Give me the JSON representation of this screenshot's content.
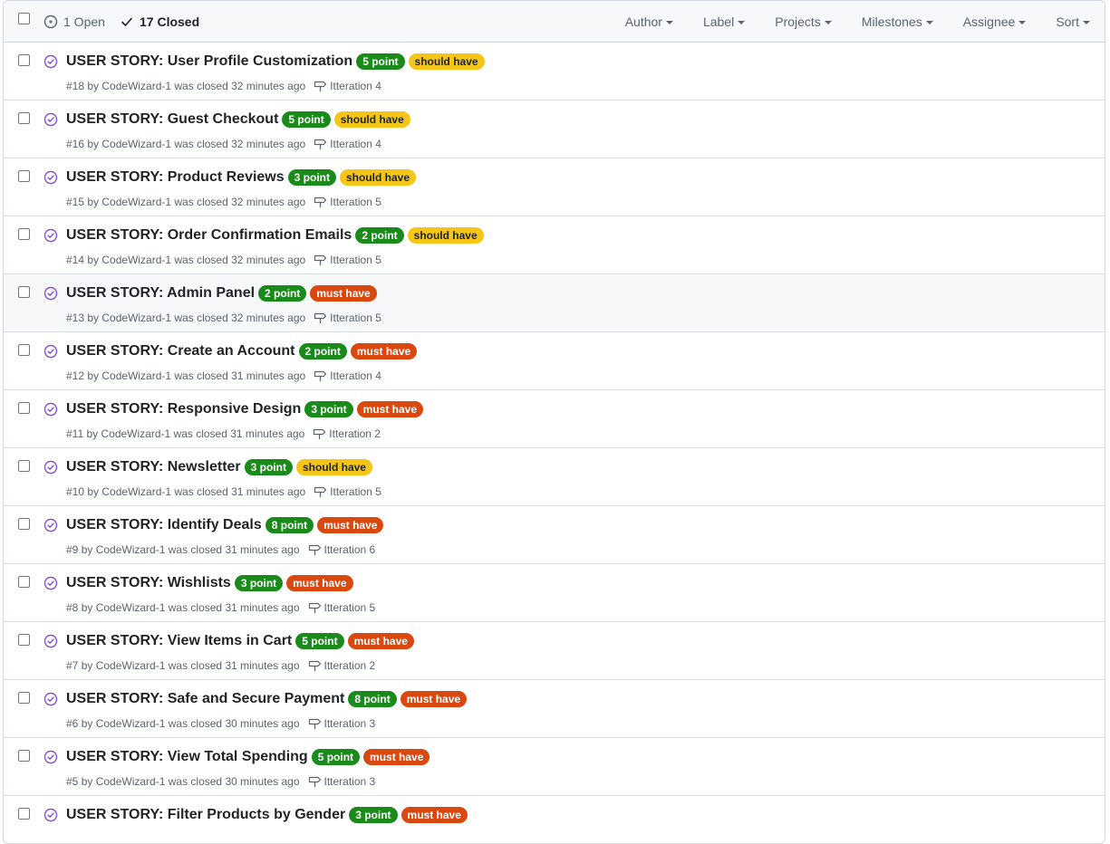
{
  "colors": {
    "point": "#1a8b1a",
    "point_text": "#ffffff",
    "should": "#f5c518",
    "should_text": "#1f2328",
    "must": "#d9480f",
    "must_text": "#ffffff",
    "closed_icon": "#8250df"
  },
  "header": {
    "open_label": "1 Open",
    "closed_label": "17 Closed",
    "filters": [
      "Author",
      "Label",
      "Projects",
      "Milestones",
      "Assignee",
      "Sort"
    ]
  },
  "issues": [
    {
      "title": "USER STORY: User Profile Customization",
      "number": "#18",
      "author": "CodeWizard-1",
      "closed": "32 minutes ago",
      "milestone": "Itteration 4",
      "labels": [
        {
          "text": "5 point",
          "kind": "point"
        },
        {
          "text": "should have",
          "kind": "should"
        }
      ]
    },
    {
      "title": "USER STORY: Guest Checkout",
      "number": "#16",
      "author": "CodeWizard-1",
      "closed": "32 minutes ago",
      "milestone": "Itteration 4",
      "labels": [
        {
          "text": "5 point",
          "kind": "point"
        },
        {
          "text": "should have",
          "kind": "should"
        }
      ]
    },
    {
      "title": "USER STORY: Product Reviews",
      "number": "#15",
      "author": "CodeWizard-1",
      "closed": "32 minutes ago",
      "milestone": "Itteration 5",
      "labels": [
        {
          "text": "3 point",
          "kind": "point"
        },
        {
          "text": "should have",
          "kind": "should"
        }
      ]
    },
    {
      "title": "USER STORY: Order Confirmation Emails",
      "number": "#14",
      "author": "CodeWizard-1",
      "closed": "32 minutes ago",
      "milestone": "Itteration 5",
      "labels": [
        {
          "text": "2 point",
          "kind": "point"
        },
        {
          "text": "should have",
          "kind": "should"
        }
      ]
    },
    {
      "title": "USER STORY: Admin Panel",
      "number": "#13",
      "author": "CodeWizard-1",
      "closed": "32 minutes ago",
      "milestone": "Itteration 5",
      "labels": [
        {
          "text": "2 point",
          "kind": "point"
        },
        {
          "text": "must have",
          "kind": "must"
        }
      ]
    },
    {
      "title": "USER STORY: Create an Account",
      "number": "#12",
      "author": "CodeWizard-1",
      "closed": "31 minutes ago",
      "milestone": "Itteration 4",
      "labels": [
        {
          "text": "2 point",
          "kind": "point"
        },
        {
          "text": "must have",
          "kind": "must"
        }
      ]
    },
    {
      "title": "USER STORY: Responsive Design",
      "number": "#11",
      "author": "CodeWizard-1",
      "closed": "31 minutes ago",
      "milestone": "Itteration 2",
      "labels": [
        {
          "text": "3 point",
          "kind": "point"
        },
        {
          "text": "must have",
          "kind": "must"
        }
      ]
    },
    {
      "title": "USER STORY: Newsletter",
      "number": "#10",
      "author": "CodeWizard-1",
      "closed": "31 minutes ago",
      "milestone": "Itteration 5",
      "labels": [
        {
          "text": "3 point",
          "kind": "point"
        },
        {
          "text": "should have",
          "kind": "should"
        }
      ]
    },
    {
      "title": "USER STORY: Identify Deals",
      "number": "#9",
      "author": "CodeWizard-1",
      "closed": "31 minutes ago",
      "milestone": "Itteration 6",
      "labels": [
        {
          "text": "8 point",
          "kind": "point"
        },
        {
          "text": "must have",
          "kind": "must"
        }
      ]
    },
    {
      "title": "USER STORY: Wishlists",
      "number": "#8",
      "author": "CodeWizard-1",
      "closed": "31 minutes ago",
      "milestone": "Itteration 5",
      "labels": [
        {
          "text": "3 point",
          "kind": "point"
        },
        {
          "text": "must have",
          "kind": "must"
        }
      ]
    },
    {
      "title": "USER STORY: View Items in Cart",
      "number": "#7",
      "author": "CodeWizard-1",
      "closed": "31 minutes ago",
      "milestone": "Itteration 2",
      "labels": [
        {
          "text": "5 point",
          "kind": "point"
        },
        {
          "text": "must have",
          "kind": "must"
        }
      ]
    },
    {
      "title": "USER STORY: Safe and Secure Payment",
      "number": "#6",
      "author": "CodeWizard-1",
      "closed": "30 minutes ago",
      "milestone": "Itteration 3",
      "labels": [
        {
          "text": "8 point",
          "kind": "point"
        },
        {
          "text": "must have",
          "kind": "must"
        }
      ]
    },
    {
      "title": "USER STORY: View Total Spending",
      "number": "#5",
      "author": "CodeWizard-1",
      "closed": "30 minutes ago",
      "milestone": "Itteration 3",
      "labels": [
        {
          "text": "5 point",
          "kind": "point"
        },
        {
          "text": "must have",
          "kind": "must"
        }
      ]
    },
    {
      "title": "USER STORY: Filter Products by Gender",
      "number": "",
      "author": "",
      "closed": "",
      "milestone": "",
      "labels": [
        {
          "text": "3 point",
          "kind": "point"
        },
        {
          "text": "must have",
          "kind": "must"
        }
      ]
    }
  ]
}
